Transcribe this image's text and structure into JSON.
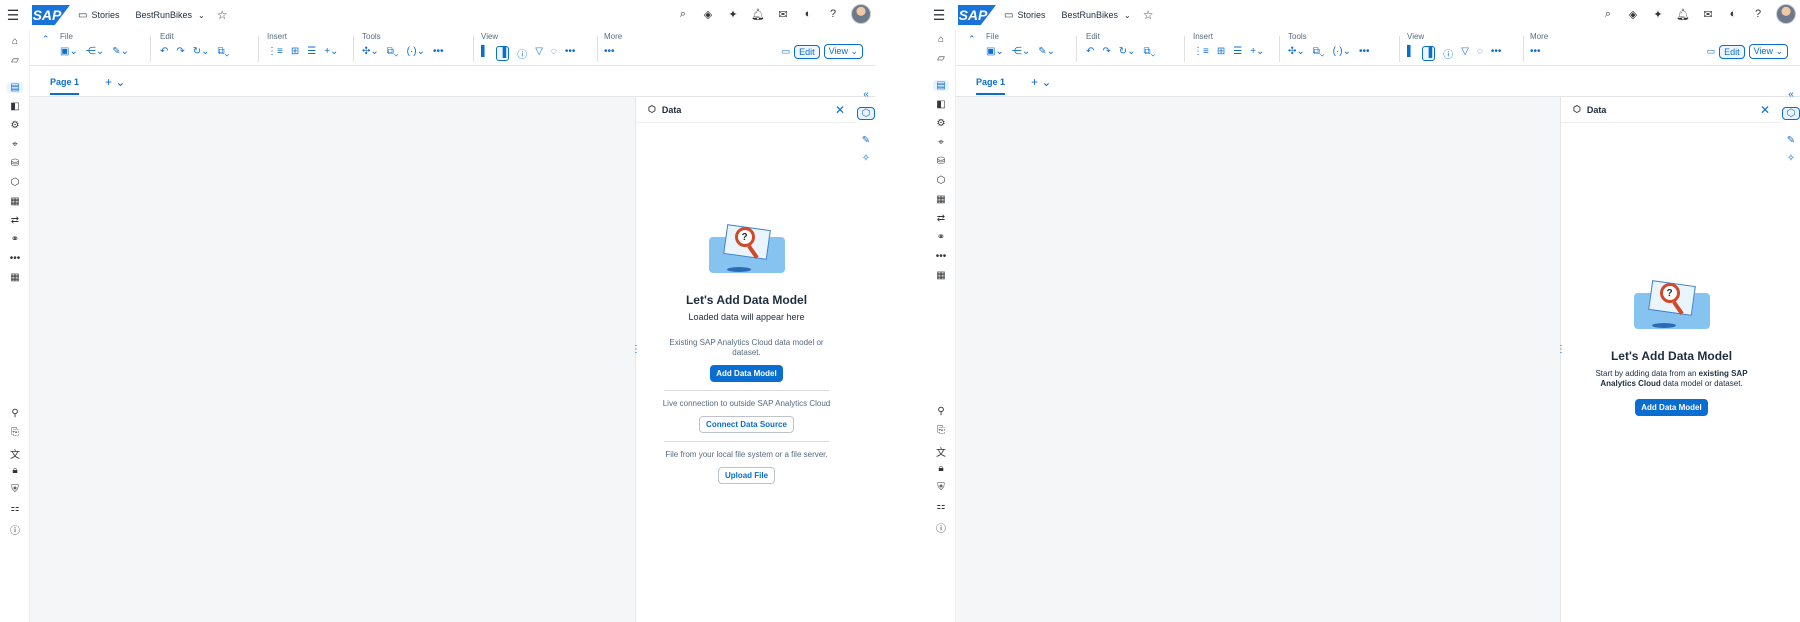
{
  "shell": {
    "menu_icon": "hamburger-icon",
    "logo": "SAP",
    "app_label": "Stories",
    "story_name": "BestRunBikes"
  },
  "toolbar": {
    "groups": {
      "file": "File",
      "edit": "Edit",
      "insert": "Insert",
      "tools": "Tools",
      "view": "View",
      "more": "More"
    },
    "edit_mode": "Edit",
    "view_mode": "View"
  },
  "tabs": {
    "page1": "Page 1"
  },
  "panel": {
    "title": "Data",
    "left": {
      "heading": "Let's Add Data Model",
      "subheading": "Loaded data will appear here",
      "existing_desc": "Existing SAP Analytics Cloud data model or dataset.",
      "add_button": "Add Data Model",
      "live_desc": "Live connection to outside SAP Analytics Cloud",
      "connect_button": "Connect Data Source",
      "file_desc": "File from your local file system or a file server.",
      "upload_button": "Upload File"
    },
    "right": {
      "heading": "Let's Add Data Model",
      "desc_pre": "Start by adding data from an ",
      "desc_bold1": "existing",
      "desc_bold2": "SAP Analytics Cloud",
      "desc_post": " data model or dataset.",
      "add_button": "Add Data Model"
    }
  },
  "colors": {
    "accent": "#0a6ed1",
    "logo": "#1a73d9",
    "canvas": "#f5f6f7"
  }
}
